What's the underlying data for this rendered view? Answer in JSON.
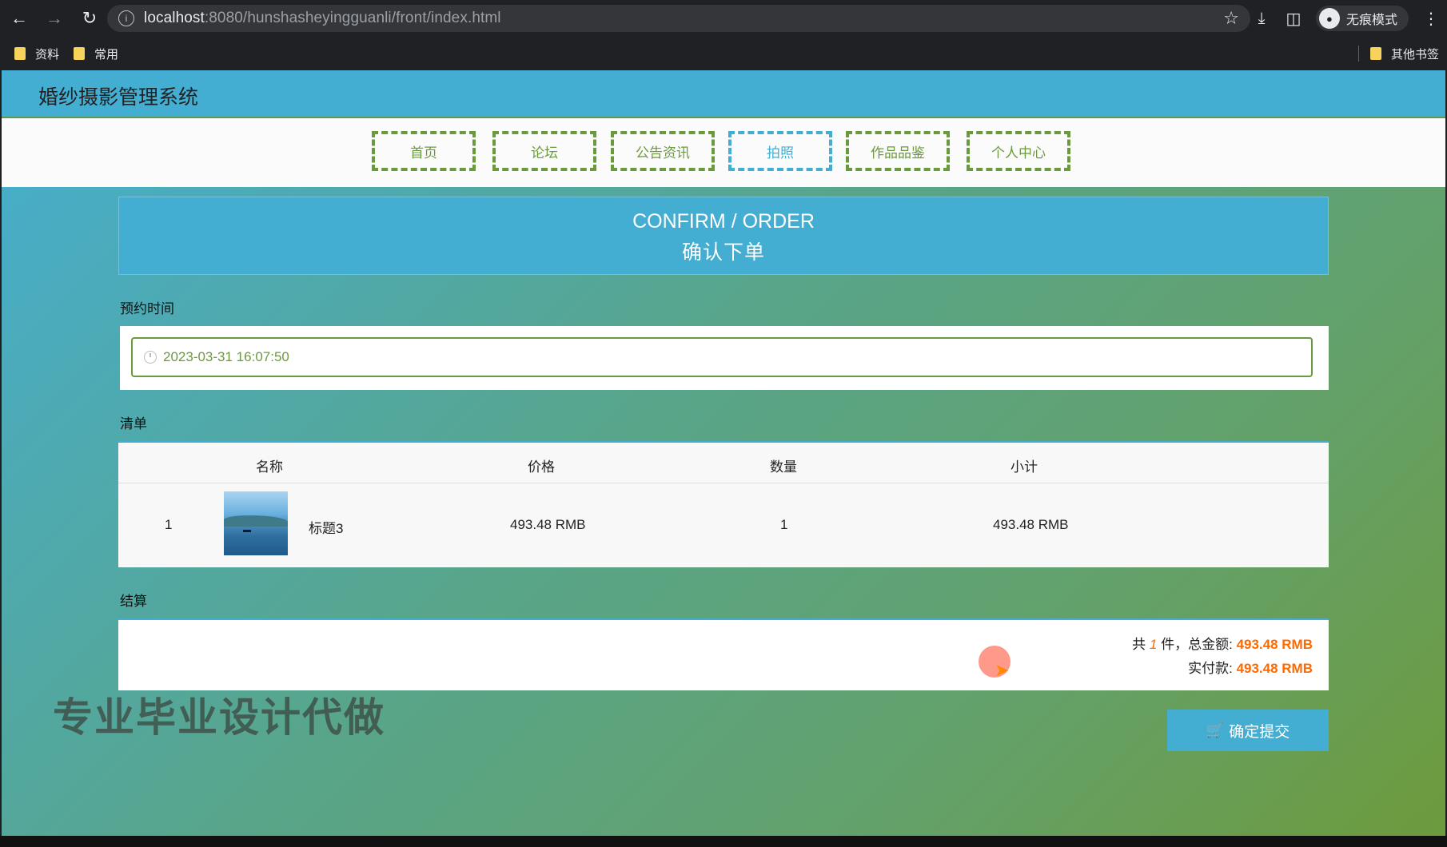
{
  "browser": {
    "url_host": "localhost",
    "url_rest": ":8080/hunshasheyingguanli/front/index.html",
    "incognito_label": "无痕模式",
    "bookmarks": [
      "资料",
      "常用"
    ],
    "other_bookmarks": "其他书签"
  },
  "site": {
    "title": "婚纱摄影管理系统",
    "nav": [
      "首页",
      "论坛",
      "公告资讯",
      "拍照",
      "作品品鉴",
      "个人中心"
    ],
    "active_nav": "拍照"
  },
  "banner": {
    "en": "CONFIRM / ORDER",
    "cn": "确认下单"
  },
  "appointment": {
    "label": "预约时间",
    "value": "2023-03-31 16:07:50"
  },
  "list": {
    "label": "清单",
    "headers": [
      "名称",
      "价格",
      "数量",
      "小计"
    ],
    "rows": [
      {
        "index": "1",
        "name": "标题3",
        "price": "493.48 RMB",
        "qty": "1",
        "subtotal": "493.48 RMB"
      }
    ]
  },
  "settlement": {
    "label": "结算",
    "prefix": "共",
    "count": "1",
    "middle": "件，总金额:",
    "total": "493.48 RMB",
    "paid_label": "实付款:",
    "paid": "493.48 RMB"
  },
  "submit_label": "确定提交",
  "watermark": "专业毕业设计代做",
  "colors": {
    "accent": "#43aed2",
    "green": "#6b9a3c",
    "price": "#ff6a00"
  }
}
